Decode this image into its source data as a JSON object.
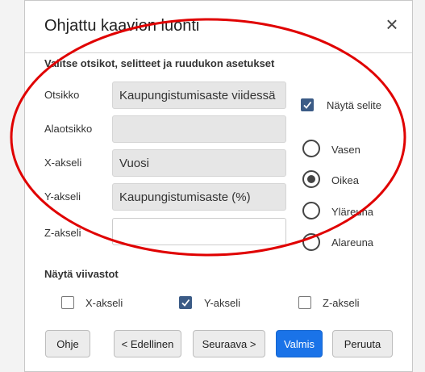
{
  "dialog": {
    "title": "Ohjattu kaavion luonti",
    "close_glyph": "×",
    "section_heading": "Valitse otsikot, selitteet ja ruudukon asetukset"
  },
  "fields": {
    "title": {
      "label": "Otsikko",
      "value": "Kaupungistumisaste viidessä"
    },
    "subtitle": {
      "label": "Alaotsikko",
      "value": ""
    },
    "x_axis": {
      "label": "X-akseli",
      "value": "Vuosi"
    },
    "y_axis": {
      "label": "Y-akseli",
      "value": "Kaupungistumisaste (%)"
    },
    "z_axis": {
      "label": "Z-akseli",
      "value": ""
    }
  },
  "legend": {
    "show_label": "Näytä selite",
    "show_checked": true,
    "positions": [
      {
        "label": "Vasen",
        "selected": false
      },
      {
        "label": "Oikea",
        "selected": true
      },
      {
        "label": "Yläreuna",
        "selected": false
      },
      {
        "label": "Alareuna",
        "selected": false
      }
    ]
  },
  "grid": {
    "heading": "Näytä viivastot",
    "options": [
      {
        "label": "X-akseli",
        "checked": false
      },
      {
        "label": "Y-akseli",
        "checked": true
      },
      {
        "label": "Z-akseli",
        "checked": false
      }
    ]
  },
  "buttons": {
    "help": "Ohje",
    "back": "< Edellinen",
    "next": "Seuraava >",
    "finish": "Valmis",
    "cancel": "Peruuta"
  },
  "colors": {
    "primary_button": "#1a73e8",
    "checkbox_checked": "#3b5b86",
    "annotation_ellipse": "#e00000"
  }
}
